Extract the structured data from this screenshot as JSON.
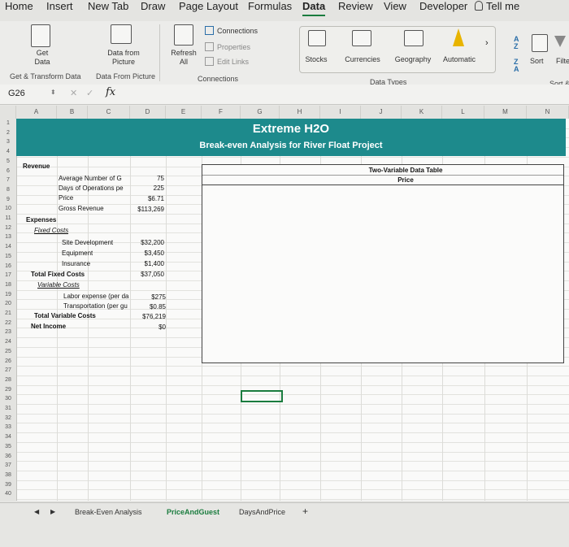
{
  "ribbon_tabs": [
    "Home",
    "Insert",
    "New Tab",
    "Draw",
    "Page Layout",
    "Formulas",
    "Data",
    "Review",
    "View",
    "Developer"
  ],
  "tell_me": "Tell me",
  "get_external": {
    "get_data": "Get\nData",
    "data_from_picture": "Data from\nPicture",
    "group_label_1": "Get & Transform Data",
    "group_label_2": "Data From Picture"
  },
  "queries": {
    "refresh_all": "Refresh\nAll",
    "connections": "Connections",
    "properties": "Properties",
    "edit_links": "Edit Links",
    "group_label": "Connections"
  },
  "data_types": {
    "stocks": "Stocks",
    "currencies": "Currencies",
    "geography": "Geography",
    "automatic": "Automatic",
    "group_label": "Data Types"
  },
  "sort": {
    "sort_label": "Sort",
    "filter_label": "Filte",
    "group_label": "Sort &"
  },
  "formula_bar": {
    "name_box": "G26",
    "fx": "fx"
  },
  "columns": [
    "A",
    "B",
    "C",
    "D",
    "E",
    "F",
    "G",
    "H",
    "I",
    "J",
    "K",
    "L",
    "M",
    "N"
  ],
  "rows": [
    "1",
    "2",
    "3",
    "4",
    "5",
    "6",
    "7",
    "8",
    "9",
    "10",
    "11",
    "12",
    "13",
    "14",
    "15",
    "16",
    "17",
    "18",
    "19",
    "20",
    "21",
    "22",
    "23",
    "24",
    "25",
    "26",
    "27",
    "28",
    "29",
    "30",
    "31",
    "32",
    "33",
    "34",
    "35",
    "36",
    "37",
    "38",
    "39",
    "40"
  ],
  "banner": {
    "title": "Extreme H2O",
    "subtitle": "Break-even Analysis for River Float Project"
  },
  "sheet": {
    "revenue": "Revenue",
    "avg_num_label": "Average Number of G",
    "avg_num_val": "75",
    "days_label": "Days of Operations pe",
    "days_val": "225",
    "price_label": "Price",
    "price_val": "$6.71",
    "gross_label": "Gross Revenue",
    "gross_val": "$113,269",
    "expenses": "Expenses",
    "fixed_costs": "Fixed Costs",
    "site_label": "Site Development",
    "site_val": "$32,200",
    "equip_label": "Equipment",
    "equip_val": "$3,450",
    "ins_label": "Insurance",
    "ins_val": "$1,400",
    "total_fixed_label": "Total Fixed Costs",
    "total_fixed_val": "$37,050",
    "variable_costs": "Variable Costs",
    "labor_label": "Labor expense (per da",
    "labor_val": "$275",
    "transport_label": "Transportation (per gu",
    "transport_val": "$0.85",
    "total_var_label": "Total Variable Costs",
    "total_var_val": "$76,219",
    "net_label": "Net Income",
    "net_val": "$0"
  },
  "data_table": {
    "title": "Two-Variable Data Table",
    "col_header": "Price"
  },
  "sheet_tabs": [
    "Break-Even Analysis",
    "PriceAndGuest",
    "DaysAndPrice"
  ],
  "active_sheet": "PriceAndGuest",
  "add_sheet": "+"
}
